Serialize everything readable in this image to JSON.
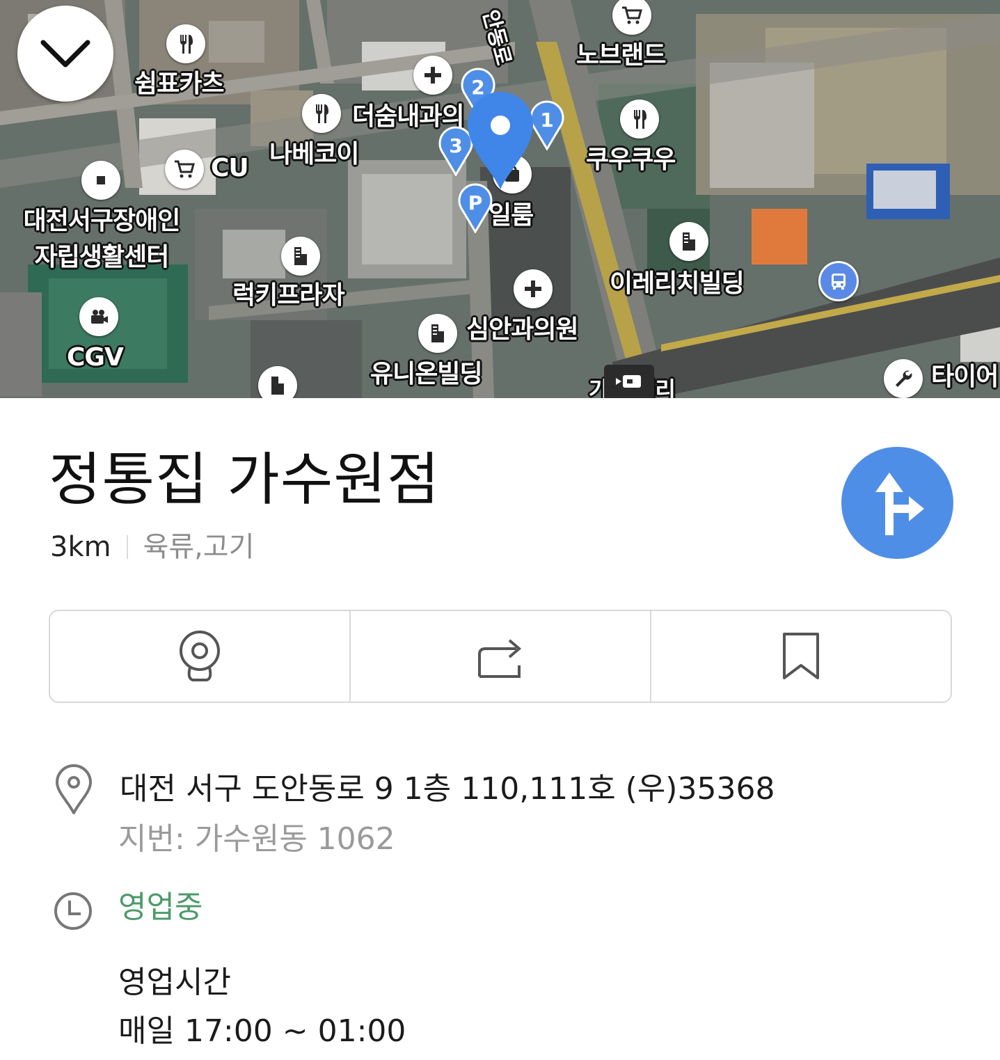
{
  "map": {
    "labels": {
      "shimpyo": "쉼표카츠",
      "nobrand": "노브랜드",
      "deosum": "더숨내과의",
      "nabekoi": "나베코이",
      "cu": "CU",
      "kuukuu": "쿠우쿠우",
      "disabled_center_1": "대전서구장애인",
      "disabled_center_2": "자립생활센터",
      "ilroom": "일룸",
      "lucky_plaza": "럭키프라자",
      "irerich": "이레리치빌딩",
      "simahn": "심안과의원",
      "cgv": "CGV",
      "union": "유니온빌딩",
      "road_vertical": "안동로",
      "intersection": "가 네거리",
      "tire": "타이어"
    },
    "pin_numbers": [
      "1",
      "2",
      "3"
    ],
    "parking_label": "P"
  },
  "place": {
    "name": "정통집 가수원점",
    "distance": "3km",
    "category": "육류,고기"
  },
  "actions": [
    "cctv-icon",
    "share-icon",
    "bookmark-icon"
  ],
  "address": {
    "main": "대전 서구 도안동로 9 1층 110,111호 (우)35368",
    "jibun": "지번: 가수원동 1062"
  },
  "status": "영업중",
  "hours": {
    "title": "영업시간",
    "value": "매일 17:00 ~ 01:00"
  },
  "colors": {
    "accent": "#4f8ee6",
    "open_status": "#4c9a6a",
    "secondary_text": "#9a9a9a"
  }
}
